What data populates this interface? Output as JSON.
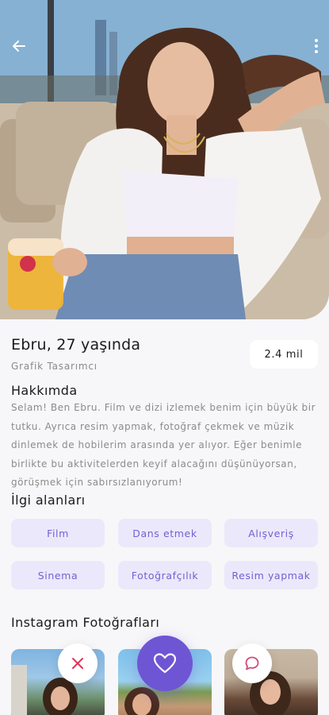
{
  "profile": {
    "name_age": "Ebru, 27 yaşında",
    "job": "Grafik Tasarımcı",
    "distance": "2.4 mil"
  },
  "about": {
    "title": "Hakkımda",
    "text": "Selam! Ben Ebru. Film ve dizi izlemek benim için büyük bir tutku. Ayrıca resim yapmak, fotoğraf çekmek ve müzik dinlemek de hobilerim arasında yer alıyor. Eğer benimle birlikte bu aktivitelerden keyif alacağını düşünüyorsan, görüşmek için sabırsızlanıyorum!"
  },
  "interests": {
    "title": "İlgi alanları",
    "items": [
      "Film",
      "Dans etmek",
      "Alışveriş",
      "Sinema",
      "Fotoğrafçılık",
      "Resim yapmak"
    ]
  },
  "instagram": {
    "title": "Instagram Fotoğrafları"
  },
  "icons": {
    "back": "arrow-left-icon",
    "more": "more-vertical-icon",
    "dislike": "close-icon",
    "like": "heart-icon",
    "chat": "chat-bubble-icon"
  },
  "colors": {
    "accent": "#6e55d4",
    "chip_bg": "#ece8fb",
    "chip_text": "#7460d0",
    "dislike": "#e0335a",
    "chat": "#d14a7a"
  }
}
